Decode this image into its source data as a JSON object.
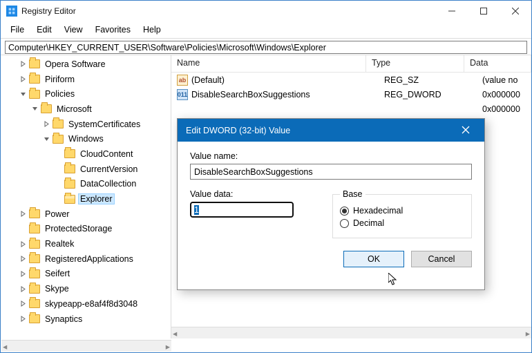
{
  "window": {
    "title": "Registry Editor",
    "menu": [
      "File",
      "Edit",
      "View",
      "Favorites",
      "Help"
    ],
    "address": "Computer\\HKEY_CURRENT_USER\\Software\\Policies\\Microsoft\\Windows\\Explorer"
  },
  "tree": [
    {
      "indent": 2,
      "tw": ">",
      "label": "Opera Software"
    },
    {
      "indent": 2,
      "tw": ">",
      "label": "Piriform"
    },
    {
      "indent": 2,
      "tw": "v",
      "label": "Policies"
    },
    {
      "indent": 3,
      "tw": "v",
      "label": "Microsoft"
    },
    {
      "indent": 4,
      "tw": ">",
      "label": "SystemCertificates"
    },
    {
      "indent": 4,
      "tw": "v",
      "label": "Windows"
    },
    {
      "indent": 5,
      "tw": "",
      "label": "CloudContent"
    },
    {
      "indent": 5,
      "tw": "",
      "label": "CurrentVersion"
    },
    {
      "indent": 5,
      "tw": "",
      "label": "DataCollection"
    },
    {
      "indent": 5,
      "tw": "",
      "label": "Explorer",
      "selected": true,
      "open": true
    },
    {
      "indent": 2,
      "tw": ">",
      "label": "Power"
    },
    {
      "indent": 2,
      "tw": "",
      "label": "ProtectedStorage"
    },
    {
      "indent": 2,
      "tw": ">",
      "label": "Realtek"
    },
    {
      "indent": 2,
      "tw": ">",
      "label": "RegisteredApplications"
    },
    {
      "indent": 2,
      "tw": ">",
      "label": "Seifert"
    },
    {
      "indent": 2,
      "tw": ">",
      "label": "Skype"
    },
    {
      "indent": 2,
      "tw": ">",
      "label": "skypeapp-e8af4f8d3048"
    },
    {
      "indent": 2,
      "tw": ">",
      "label": "Synaptics"
    }
  ],
  "list": {
    "headers": {
      "name": "Name",
      "type": "Type",
      "data": "Data"
    },
    "rows": [
      {
        "icon": "sz",
        "name": "(Default)",
        "type": "REG_SZ",
        "data": "(value no"
      },
      {
        "icon": "dw",
        "name": "DisableSearchBoxSuggestions",
        "type": "REG_DWORD",
        "data": "0x000000"
      },
      {
        "icon": "",
        "name": "",
        "type": "",
        "data": "0x000000"
      }
    ]
  },
  "dialog": {
    "title": "Edit DWORD (32-bit) Value",
    "value_name_label": "Value name:",
    "value_name": "DisableSearchBoxSuggestions",
    "value_data_label": "Value data:",
    "value_data": "1",
    "base_label": "Base",
    "hex": "Hexadecimal",
    "dec": "Decimal",
    "ok": "OK",
    "cancel": "Cancel"
  }
}
